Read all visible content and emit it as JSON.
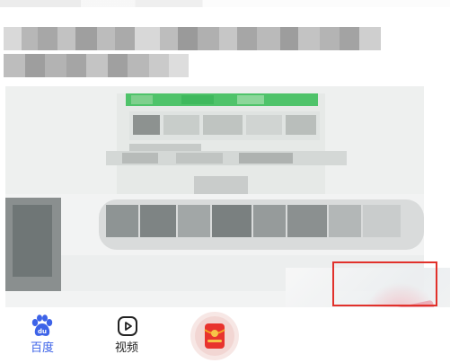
{
  "bottom_nav": {
    "home_label": "百度",
    "home_icon_text": "du",
    "video_label": "视频",
    "redpack_icon": "red-envelope-icon"
  },
  "colors": {
    "accent_blue": "#3d63e8",
    "highlight_red": "#e1312b",
    "redpack_red": "#e8332e",
    "green_bar": "#4fc36a"
  }
}
